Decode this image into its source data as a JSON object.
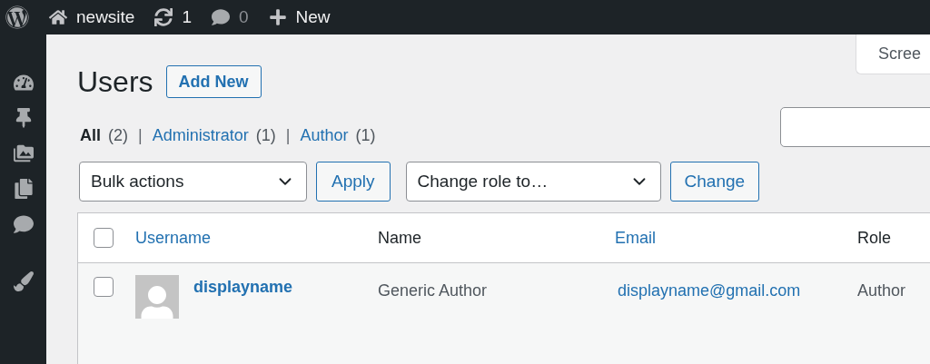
{
  "admin_bar": [
    {
      "kind": "logo"
    },
    {
      "kind": "site",
      "label": "newsite"
    },
    {
      "kind": "updates",
      "label": "1"
    },
    {
      "kind": "comments",
      "label": "0"
    },
    {
      "kind": "new",
      "label": "New"
    }
  ],
  "sidebar": [
    {
      "kind": "dashboard"
    },
    {
      "kind": "posts"
    },
    {
      "kind": "media"
    },
    {
      "kind": "pages"
    },
    {
      "kind": "comments"
    },
    {
      "kind": "appearance"
    }
  ],
  "screen_options": "Scree",
  "title": "Users",
  "add_new": "Add New",
  "filters": [
    {
      "label": "All",
      "count": "(2)",
      "selected": true
    },
    {
      "separator": "|",
      "label": "Administrator",
      "count": "(1)",
      "selected": false
    },
    {
      "separator": "|",
      "label": "Author",
      "count": "(1)",
      "selected": false
    }
  ],
  "bulk_actions": {
    "value": "Bulk actions",
    "button": "Apply"
  },
  "change_role": {
    "value": "Change role to…",
    "button": "Change"
  },
  "table": {
    "header_checked": false,
    "columns": [
      {
        "label": "Username",
        "sortable": true
      },
      {
        "label": "Name",
        "sortable": false
      },
      {
        "label": "Email",
        "sortable": true
      },
      {
        "label": "Role",
        "sortable": false
      }
    ],
    "rows": [
      {
        "checked": false,
        "username": "displayname",
        "name": "Generic Author",
        "email": "displayname@gmail.com",
        "role": "Author"
      }
    ]
  }
}
